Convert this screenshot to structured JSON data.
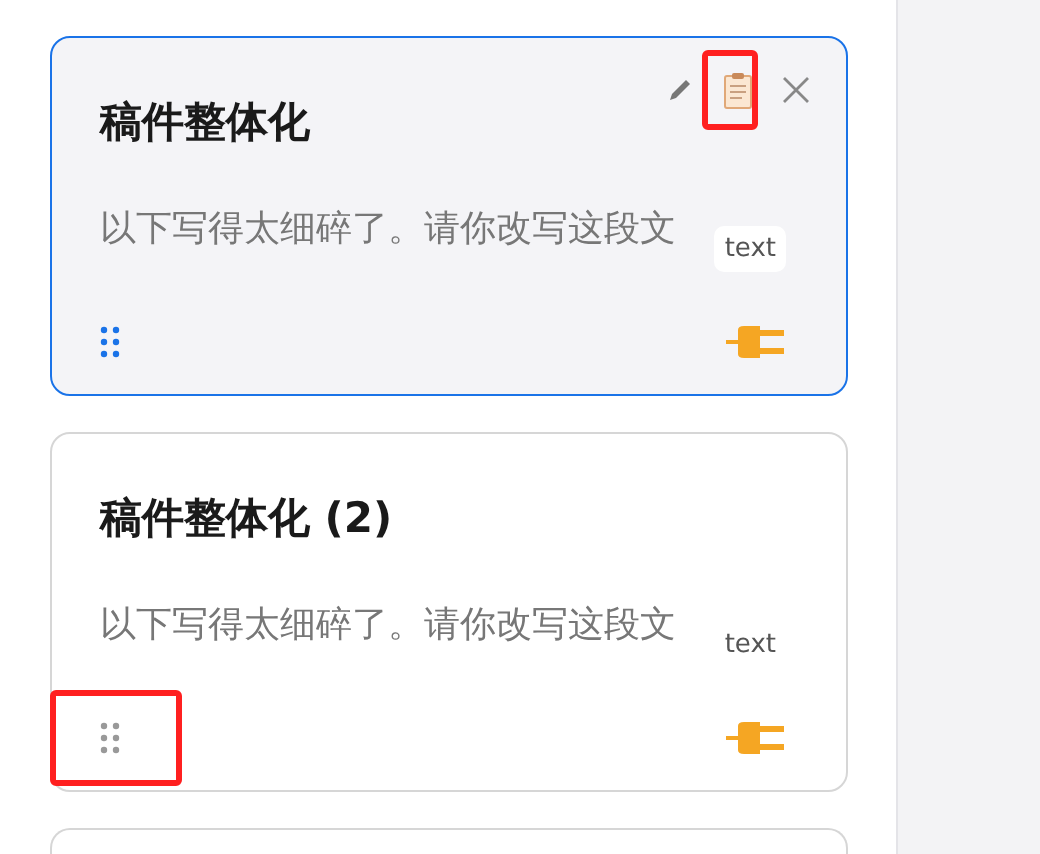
{
  "cards": [
    {
      "title": "稿件整体化",
      "text": "以下写得太细碎了。请你改写这段文",
      "tag": "text",
      "selected": true,
      "actions": true,
      "copy_highlighted": true,
      "handle_highlighted": false
    },
    {
      "title": "稿件整体化 (2)",
      "text": "以下写得太细碎了。请你改写这段文",
      "tag": "text",
      "selected": false,
      "actions": false,
      "copy_highlighted": false,
      "handle_highlighted": true
    }
  ]
}
